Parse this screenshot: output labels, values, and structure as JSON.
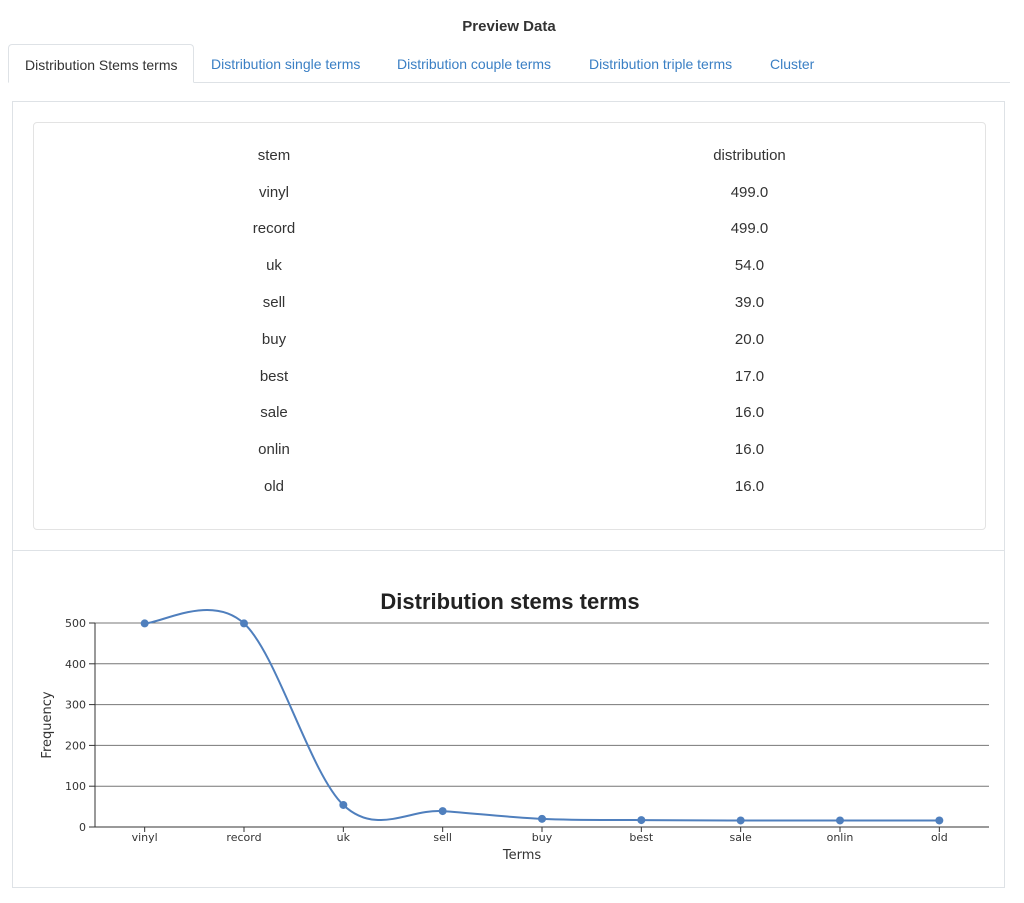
{
  "page": {
    "title": "Preview Data"
  },
  "tabs": [
    {
      "label": "Distribution Stems terms",
      "active": true
    },
    {
      "label": "Distribution single terms",
      "active": false
    },
    {
      "label": "Distribution couple terms",
      "active": false
    },
    {
      "label": "Distribution triple terms",
      "active": false
    },
    {
      "label": "Cluster",
      "active": false
    }
  ],
  "table": {
    "headers": [
      "stem",
      "distribution"
    ],
    "rows": [
      [
        "vinyl",
        "499.0"
      ],
      [
        "record",
        "499.0"
      ],
      [
        "uk",
        "54.0"
      ],
      [
        "sell",
        "39.0"
      ],
      [
        "buy",
        "20.0"
      ],
      [
        "best",
        "17.0"
      ],
      [
        "sale",
        "16.0"
      ],
      [
        "onlin",
        "16.0"
      ],
      [
        "old",
        "16.0"
      ]
    ]
  },
  "chart_data": {
    "type": "line",
    "title": "Distribution stems terms",
    "xlabel": "Terms",
    "ylabel": "Frequency",
    "categories": [
      "vinyl",
      "record",
      "uk",
      "sell",
      "buy",
      "best",
      "sale",
      "onlin",
      "old"
    ],
    "series": [
      {
        "values": [
          499,
          499,
          54,
          39,
          20,
          17,
          16,
          16,
          16
        ]
      }
    ],
    "ylim": [
      0,
      500
    ],
    "yticks": [
      0,
      100,
      200,
      300,
      400,
      500
    ],
    "grid": true,
    "color": "#4f7fbd"
  }
}
